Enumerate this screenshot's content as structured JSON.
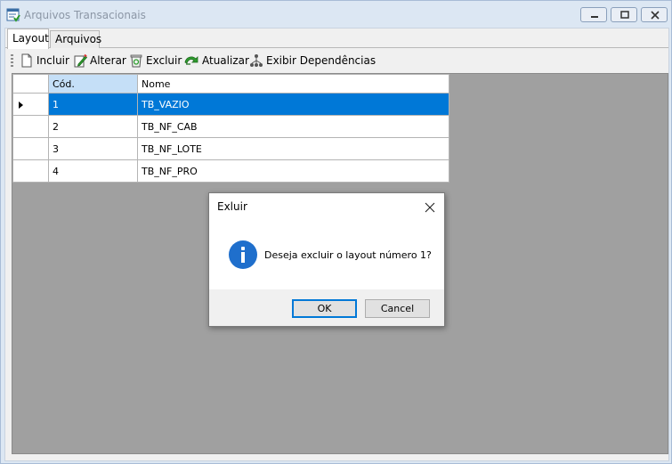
{
  "window": {
    "title": "Arquivos Transacionais"
  },
  "tabs": [
    {
      "label": "Layout",
      "active": true
    },
    {
      "label": "Arquivos",
      "active": false
    }
  ],
  "toolbar": {
    "incluir": "Incluir",
    "alterar": "Alterar",
    "excluir": "Excluir",
    "atualizar": "Atualizar",
    "dependencias": "Exibir Dependências"
  },
  "grid": {
    "columns": [
      "Cód.",
      "Nome"
    ],
    "rows": [
      {
        "cod": "1",
        "nome": "TB_VAZIO"
      },
      {
        "cod": "2",
        "nome": "TB_NF_CAB"
      },
      {
        "cod": "3",
        "nome": "TB_NF_LOTE"
      },
      {
        "cod": "4",
        "nome": "TB_NF_PRO"
      }
    ],
    "selected_row": 0
  },
  "dialog": {
    "title": "Exluir",
    "message": "Deseja excluir o layout número 1?",
    "ok_label": "OK",
    "cancel_label": "Cancel"
  },
  "colors": {
    "selection": "#0078d7",
    "header_selected": "#c5dff7",
    "grid_background": "#a0a0a0",
    "info_icon": "#1f6fcc"
  }
}
